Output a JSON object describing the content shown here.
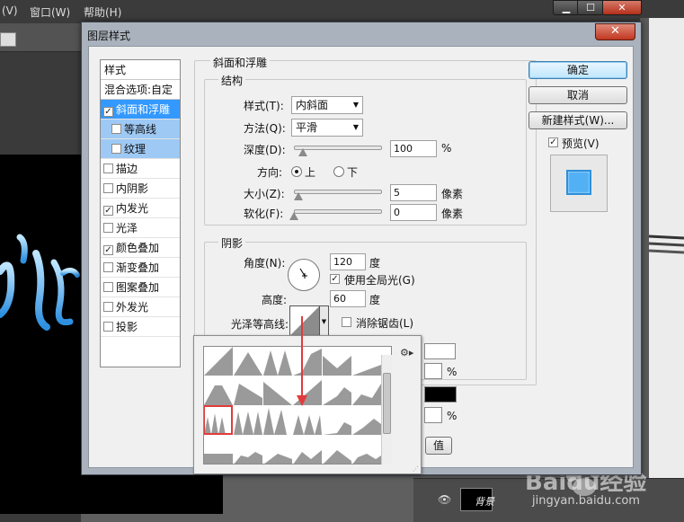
{
  "app": {
    "menu": [
      "(V)",
      "窗口(W)",
      "帮助(H)"
    ],
    "layer_name": "背景",
    "window_controls": [
      "▁",
      "☐",
      "✕"
    ]
  },
  "dialog": {
    "title": "图层样式",
    "close_label": "✕",
    "style_list": {
      "header": "样式",
      "blend_options": "混合选项:自定",
      "items": [
        {
          "label": "斜面和浮雕",
          "checked": true,
          "selected": true
        },
        {
          "label": "等高线",
          "checked": false,
          "sub": true
        },
        {
          "label": "纹理",
          "checked": false,
          "sub": true
        },
        {
          "label": "描边",
          "checked": false
        },
        {
          "label": "内阴影",
          "checked": false
        },
        {
          "label": "内发光",
          "checked": true
        },
        {
          "label": "光泽",
          "checked": false
        },
        {
          "label": "颜色叠加",
          "checked": true
        },
        {
          "label": "渐变叠加",
          "checked": false
        },
        {
          "label": "图案叠加",
          "checked": false
        },
        {
          "label": "外发光",
          "checked": false
        },
        {
          "label": "投影",
          "checked": false
        }
      ]
    },
    "bevel": {
      "section_title": "斜面和浮雕",
      "structure_title": "结构",
      "style_label": "样式(T):",
      "style_value": "内斜面",
      "method_label": "方法(Q):",
      "method_value": "平滑",
      "depth_label": "深度(D):",
      "depth_value": "100",
      "depth_unit": "%",
      "depth_level": 0.1,
      "direction_label": "方向:",
      "direction_up": "上",
      "direction_down": "下",
      "size_label": "大小(Z):",
      "size_value": "5",
      "size_unit": "像素",
      "size_level": 0.05,
      "soften_label": "软化(F):",
      "soften_value": "0",
      "soften_unit": "像素",
      "soften_level": 0.0
    },
    "shading": {
      "title": "阴影",
      "angle_label": "角度(N):",
      "angle_value": "120",
      "angle_unit": "度",
      "global_light_label": "使用全局光(G)",
      "global_light_checked": true,
      "altitude_label": "高度:",
      "altitude_value": "60",
      "altitude_unit": "度",
      "gloss_contour_label": "光泽等高线:",
      "antialias_label": "消除锯齿(L)",
      "antialias_checked": false,
      "percent_1": "%",
      "percent_2": "%",
      "reset_default_fragment": "值"
    },
    "buttons": {
      "ok": "确定",
      "cancel": "取消",
      "new_style": "新建样式(W)...",
      "preview_label": "预览(V)",
      "preview_checked": true
    },
    "colors": {
      "preview_fill": "#52b0f4",
      "shadow_color": "#000000",
      "highlight_border": "#e23b3b"
    },
    "contour_popup": {
      "menu_icon": "gear-icon",
      "selected_index": 13
    }
  },
  "watermark": {
    "brand": "Baidu经验",
    "url": "jingyan.baidu.com"
  }
}
